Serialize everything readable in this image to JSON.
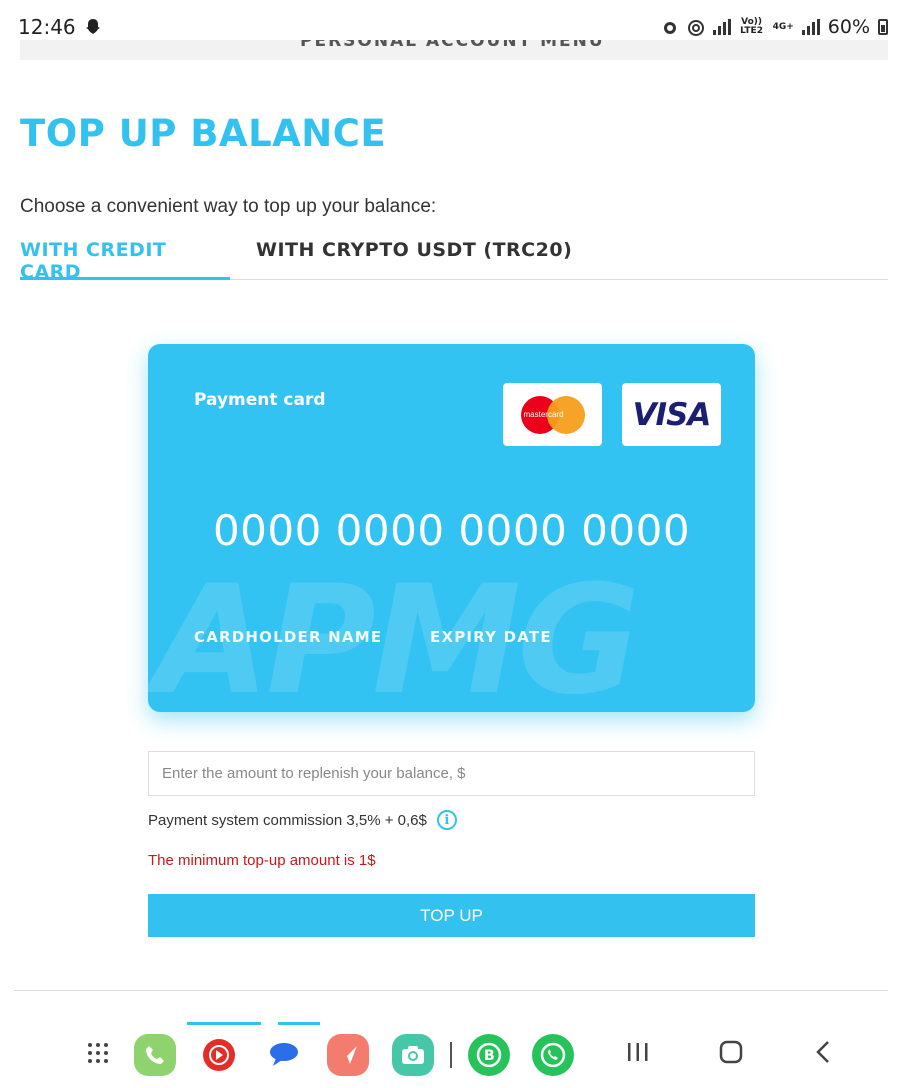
{
  "status_bar": {
    "time": "12:46",
    "network_label": "Vo)) LTE2",
    "network_type": "4G+",
    "battery": "60%"
  },
  "menu_strip": {
    "label": "PERSONAL ACCOUNT MENU"
  },
  "page": {
    "title": "TOP UP BALANCE",
    "subtitle": "Choose a convenient way to top up your balance:"
  },
  "tabs": [
    {
      "label": "WITH CREDIT CARD",
      "active": true
    },
    {
      "label": "WITH CRYPTO USDT (TRC20)",
      "active": false
    }
  ],
  "card": {
    "label": "Payment card",
    "mastercard_text": "mastercard",
    "visa_text": "VISA",
    "number": "0000 0000 0000 0000",
    "holder_label": "CARDHOLDER NAME",
    "expiry_label": "EXPIRY DATE",
    "watermark": "APMG"
  },
  "form": {
    "amount_placeholder": "Enter the amount to replenish your balance, $",
    "amount_value": "",
    "commission": "Payment system commission 3,5% + 0,6$",
    "info_icon_glyph": "i",
    "min_amount": "The minimum top-up amount is 1$",
    "submit_label": "TOP UP"
  },
  "colors": {
    "accent": "#33c1ef",
    "error": "#c41a1a",
    "text": "#333333"
  },
  "dock": {
    "apps": [
      "apps-grid-icon",
      "phone-icon",
      "youtube-music-icon",
      "messages-icon",
      "navigation-icon",
      "camera-icon",
      "whatsapp-business-icon",
      "whatsapp-icon"
    ],
    "nav": [
      "recents-icon",
      "home-icon",
      "back-icon"
    ]
  }
}
